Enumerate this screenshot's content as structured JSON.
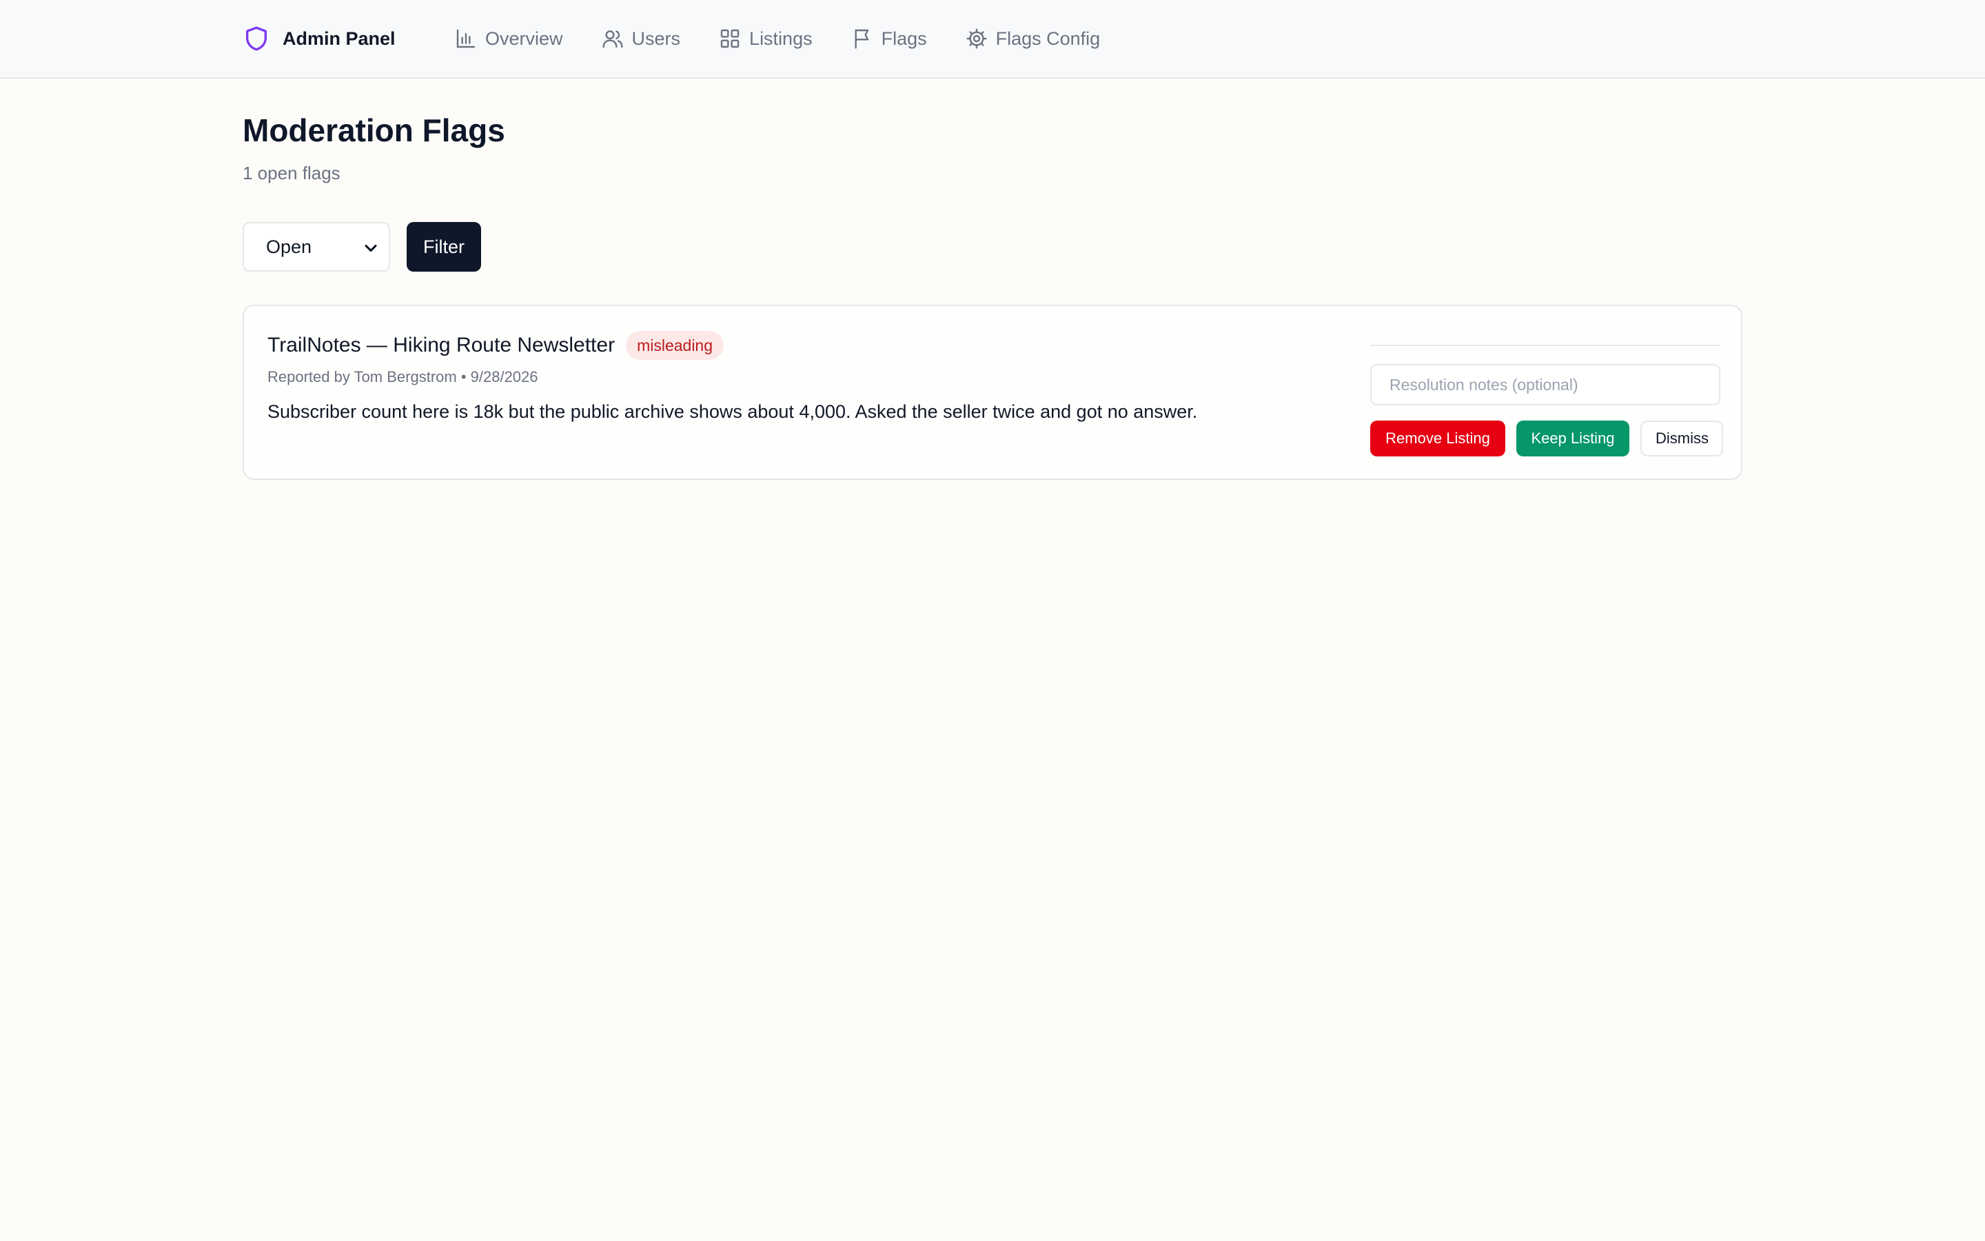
{
  "app": {
    "name": "Admin Panel",
    "logo_icon": "shield-icon",
    "brand_color": "#7c3aed"
  },
  "nav": {
    "items": [
      {
        "label": "Overview",
        "icon": "bar-chart-icon"
      },
      {
        "label": "Users",
        "icon": "users-icon"
      },
      {
        "label": "Listings",
        "icon": "grid-icon"
      },
      {
        "label": "Flags",
        "icon": "flag-icon"
      },
      {
        "label": "Flags Config",
        "icon": "gear-icon"
      }
    ]
  },
  "page": {
    "title": "Moderation Flags",
    "subtitle": "1 open flags"
  },
  "filters": {
    "status_selected": "Open",
    "filter_label": "Filter"
  },
  "flags": [
    {
      "listing_title": "TrailNotes — Hiking Route Newsletter",
      "reason": "misleading",
      "meta": "Reported by Tom Bergstrom • 9/28/2026",
      "description": "Subscriber count here is 18k but the public archive shows about 4,000. Asked the seller twice and got no answer.",
      "notes_placeholder": "Resolution notes (optional)",
      "actions": {
        "remove": "Remove Listing",
        "keep": "Keep Listing",
        "dismiss": "Dismiss"
      }
    }
  ],
  "colors": {
    "remove": "#e60012",
    "keep": "#059669",
    "reason_badge_bg": "#fde8e8",
    "reason_badge_text": "#b91c1c",
    "primary_dark": "#0f172a"
  }
}
